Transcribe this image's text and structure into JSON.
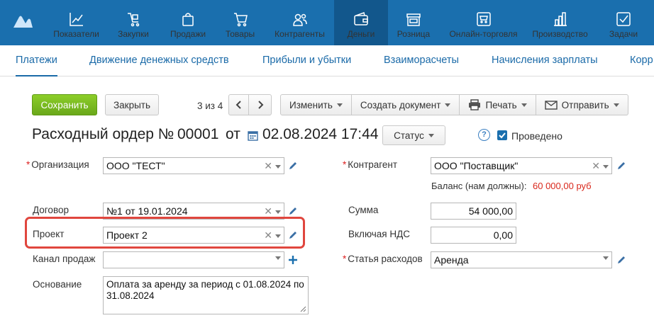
{
  "nav": {
    "items": [
      {
        "label": "Показатели",
        "icon": "chart-line-icon"
      },
      {
        "label": "Закупки",
        "icon": "cart-hand-icon"
      },
      {
        "label": "Продажи",
        "icon": "shopping-bag-icon"
      },
      {
        "label": "Товары",
        "icon": "cart-icon"
      },
      {
        "label": "Контрагенты",
        "icon": "people-icon"
      },
      {
        "label": "Деньги",
        "icon": "wallet-icon"
      },
      {
        "label": "Розница",
        "icon": "store-icon"
      },
      {
        "label": "Онлайн-торговля",
        "icon": "online-store-icon"
      },
      {
        "label": "Производство",
        "icon": "factory-icon"
      },
      {
        "label": "Задачи",
        "icon": "task-check-icon"
      }
    ],
    "active": "Деньги"
  },
  "subnav": {
    "tabs": [
      "Платежи",
      "Движение денежных средств",
      "Прибыли и убытки",
      "Взаиморасчеты",
      "Начисления зарплаты",
      "Корр"
    ],
    "active": "Платежи"
  },
  "toolbar": {
    "save": "Сохранить",
    "close": "Закрыть",
    "pager": "3 из 4",
    "edit": "Изменить",
    "create_doc": "Создать документ",
    "print": "Печать",
    "send": "Отправить"
  },
  "doc": {
    "title_prefix": "Расходный ордер №",
    "number": "00001",
    "from": "от",
    "date": "02.08.2024 17:44",
    "status": "Статус",
    "help": "?",
    "posted": "Проведено"
  },
  "form": {
    "org_label": "Организация",
    "org_value": "ООО \"ТЕСТ\"",
    "counterparty_label": "Контрагент",
    "counterparty_value": "ООО \"Поставщик\"",
    "balance_label": "Баланс (нам должны):",
    "balance_value": "60 000,00 руб",
    "contract_label": "Договор",
    "contract_value": "№1 от 19.01.2024",
    "sum_label": "Сумма",
    "sum_value": "54 000,00",
    "project_label": "Проект",
    "project_value": "Проект 2",
    "vat_label": "Включая НДС",
    "vat_value": "0,00",
    "channel_label": "Канал продаж",
    "channel_value": "",
    "expense_label": "Статья расходов",
    "expense_value": "Аренда",
    "basis_label": "Основание",
    "basis_value": "Оплата за аренду за период с 01.08.2024 по 31.08.2024"
  },
  "colors": {
    "nav_bg": "#1a6fae",
    "accent": "#1a6aa8",
    "save_green": "#7bbf22",
    "balance_red": "#d9281c",
    "highlight": "#e0463e"
  }
}
